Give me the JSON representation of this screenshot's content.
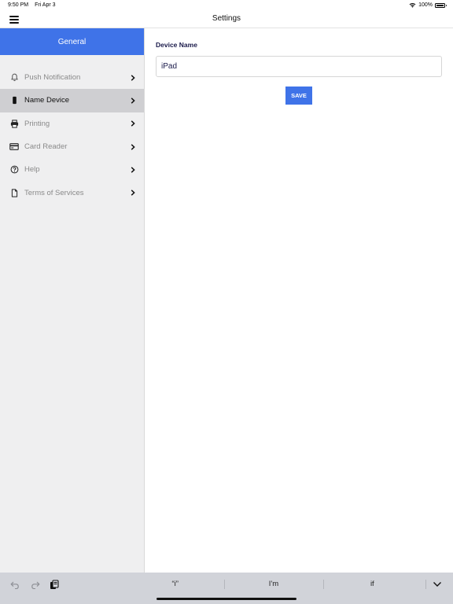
{
  "status_bar": {
    "time": "9:50 PM",
    "date": "Fri Apr 3",
    "battery": "100%"
  },
  "nav": {
    "title": "Settings"
  },
  "sidebar": {
    "header": "General",
    "items": [
      {
        "label": "Push Notification",
        "icon": "bell-icon",
        "active": false
      },
      {
        "label": "Name Device",
        "icon": "phone-icon",
        "active": true
      },
      {
        "label": "Printing",
        "icon": "printer-icon",
        "active": false
      },
      {
        "label": "Card Reader",
        "icon": "credit-card-icon",
        "active": false
      },
      {
        "label": "Help",
        "icon": "help-circle-icon",
        "active": false
      },
      {
        "label": "Terms of Services",
        "icon": "document-icon",
        "active": false
      }
    ]
  },
  "main": {
    "field_label": "Device Name",
    "field_value": "iPad",
    "save_label": "SAVE"
  },
  "keyboard": {
    "suggestions": [
      "“i”",
      "I'm",
      "if"
    ]
  },
  "colors": {
    "accent": "#3f73e8",
    "sidebar_bg": "#efeff0",
    "active_item_bg": "#cfcfd2",
    "keyboard_bg": "#d1d3d9"
  }
}
